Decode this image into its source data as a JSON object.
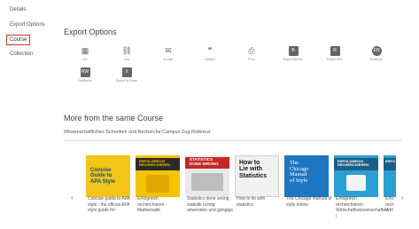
{
  "sidebar": {
    "items": [
      {
        "label": "Details"
      },
      {
        "label": "Export Options"
      },
      {
        "label": "Course",
        "active": true
      },
      {
        "label": "Collection"
      }
    ]
  },
  "export": {
    "title": "Export Options",
    "options": [
      {
        "label": "QR",
        "icon": "qr-code-icon",
        "glyph": "▦"
      },
      {
        "label": "Link",
        "icon": "link-icon",
        "glyph": "⛓"
      },
      {
        "label": "E-mail",
        "icon": "email-icon",
        "glyph": "✉"
      },
      {
        "label": "Citation",
        "icon": "citation-icon",
        "glyph": "❞"
      },
      {
        "label": "Print",
        "icon": "print-icon",
        "glyph": "⎙"
      },
      {
        "label": "Export BibTeX",
        "icon": "bibtex-icon",
        "glyph": "B"
      },
      {
        "label": "Export RIS",
        "icon": "ris-icon",
        "glyph": "R"
      },
      {
        "label": "EndNote",
        "icon": "endnote-icon",
        "glyph": "EN"
      },
      {
        "label": "RefWorks",
        "icon": "refworks-icon",
        "glyph": "RW"
      },
      {
        "label": "Export to Excel",
        "icon": "excel-icon",
        "glyph": "X"
      }
    ]
  },
  "course": {
    "title": "More from the same Course",
    "subtitle": "Wissenschaftliches Schreiben und Recherche Campus-Zug-Rotkreuz",
    "prev_glyph": "‹",
    "next_glyph": "›",
    "books": [
      {
        "caption": "Concise guide to APA style : the official APA style guide for",
        "cover": [
          "Concise",
          "Guide to",
          "APA Style"
        ],
        "cover_bg": "#f2c518",
        "cover_fg": "#0d4f80"
      },
      {
        "caption": "Erfolgreich recherchieren - Mathematik",
        "cover": [
          "ERFOLGREICH",
          "RECHERCHIEREN"
        ],
        "cover_bg": "#f4c400",
        "cover_fg": "#222222"
      },
      {
        "caption": "Statistics done wrong : statistik richtig anwenden und gängige",
        "cover": [
          "STATISTICS",
          "DONE WRONG"
        ],
        "cover_bg": "#e9e9e9",
        "cover_fg": "#222222"
      },
      {
        "caption": "How to lie with statistics",
        "cover": [
          "How to",
          "Lie with",
          "Statistics"
        ],
        "cover_bg": "#f1f1f1",
        "cover_fg": "#111111"
      },
      {
        "caption": "The Chicago manual of style online",
        "cover": [
          "The",
          "Chicago",
          "Manual",
          "of Style"
        ],
        "cover_bg": "#1f76c0",
        "cover_fg": "#ffffff"
      },
      {
        "caption": "Erfolgreich recherchieren : Wirtschaftswissenschaften /",
        "cover": [
          "ERFOLGREICH",
          "RECHERCHIEREN"
        ],
        "cover_bg": "#2a9fd4",
        "cover_fg": "#ffffff"
      },
      {
        "caption": "Erfo rech Wirt",
        "cover": [
          "ERFO"
        ],
        "cover_bg": "#2a9fd4",
        "cover_fg": "#ffffff"
      }
    ]
  }
}
